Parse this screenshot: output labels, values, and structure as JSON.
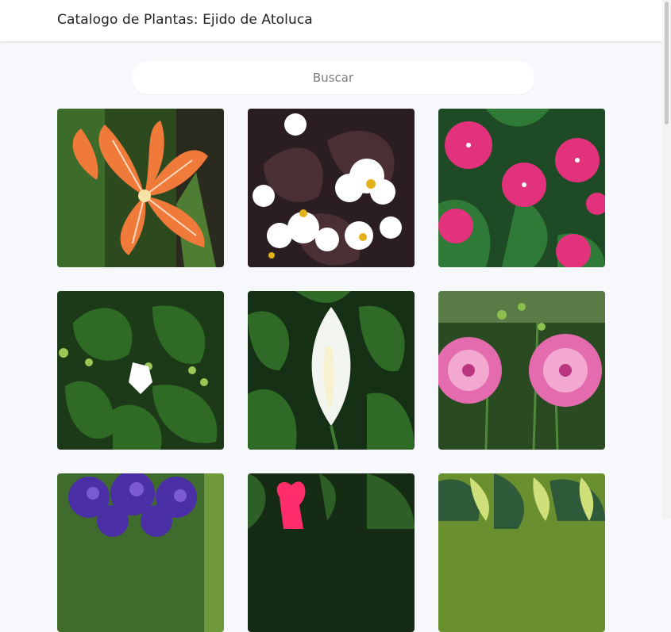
{
  "header": {
    "title": "Catalogo de Plantas: Ejido de Atoluca"
  },
  "search": {
    "placeholder": "Buscar"
  },
  "plants": [
    {
      "image": "orange-amaryllis-photo"
    },
    {
      "image": "white-begonia-photo"
    },
    {
      "image": "pink-impatiens-photo"
    },
    {
      "image": "white-bud-plant-photo"
    },
    {
      "image": "peace-lily-photo"
    },
    {
      "image": "pink-dahlia-photo"
    },
    {
      "image": "purple-delphinium-photo"
    },
    {
      "image": "pink-flower-photo"
    },
    {
      "image": "variegated-foliage-photo"
    }
  ]
}
